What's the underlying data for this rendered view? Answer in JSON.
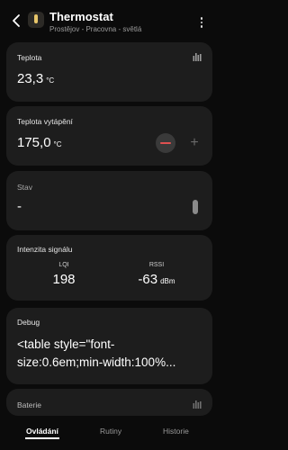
{
  "header": {
    "title": "Thermostat",
    "subtitle": "Prostějov - Pracovna - světlá"
  },
  "cards": {
    "teplota": {
      "title": "Teplota",
      "value": "23,3",
      "unit": "°C"
    },
    "teplota_vytapeni": {
      "title": "Teplota vytápění",
      "value": "175,0",
      "unit": "°C"
    },
    "stav": {
      "title": "Stav",
      "value": "-"
    },
    "signal": {
      "title": "Intenzita signálu",
      "lqi_label": "LQI",
      "lqi_value": "198",
      "rssi_label": "RSSI",
      "rssi_value": "-63",
      "rssi_unit": "dBm"
    },
    "debug": {
      "title": "Debug",
      "text": "<table style=\"font-\nsize:0.6em;min-width:100%..."
    },
    "baterie": {
      "title": "Baterie"
    }
  },
  "tabs": [
    "Ovládání",
    "Rutiny",
    "Historie"
  ],
  "colors": {
    "accent_minus": "#e05151",
    "card_bg": "#1d1d1d"
  },
  "icons": [
    "back-arrow-icon",
    "thermostat-app-icon",
    "more-icon",
    "chart-bars-icon",
    "minus-icon",
    "plus-icon"
  ]
}
